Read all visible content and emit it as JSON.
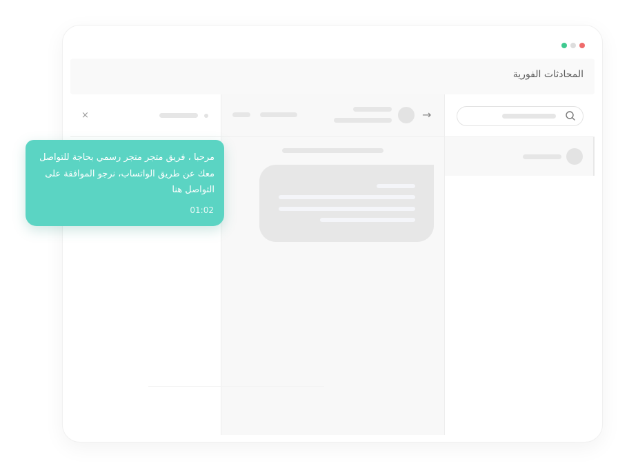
{
  "app": {
    "title": "المحادثات الفورية"
  },
  "window_controls": {
    "colors": [
      "#3ec98f",
      "#dddddd",
      "#ef6b6b"
    ]
  },
  "conversation": {
    "close_glyph": "×",
    "back_glyph": "→"
  },
  "notification": {
    "message": "مرحبا ، فريق متجر متجر رسمي بحاجة للتواصل معك عن طريق الواتساب، نرجو الموافقة على التواصل هنا",
    "time": "01:02",
    "color": "#5bd4c3"
  },
  "icons": {
    "search": "search-icon",
    "close": "close-icon",
    "arrow": "arrow-right-icon"
  }
}
